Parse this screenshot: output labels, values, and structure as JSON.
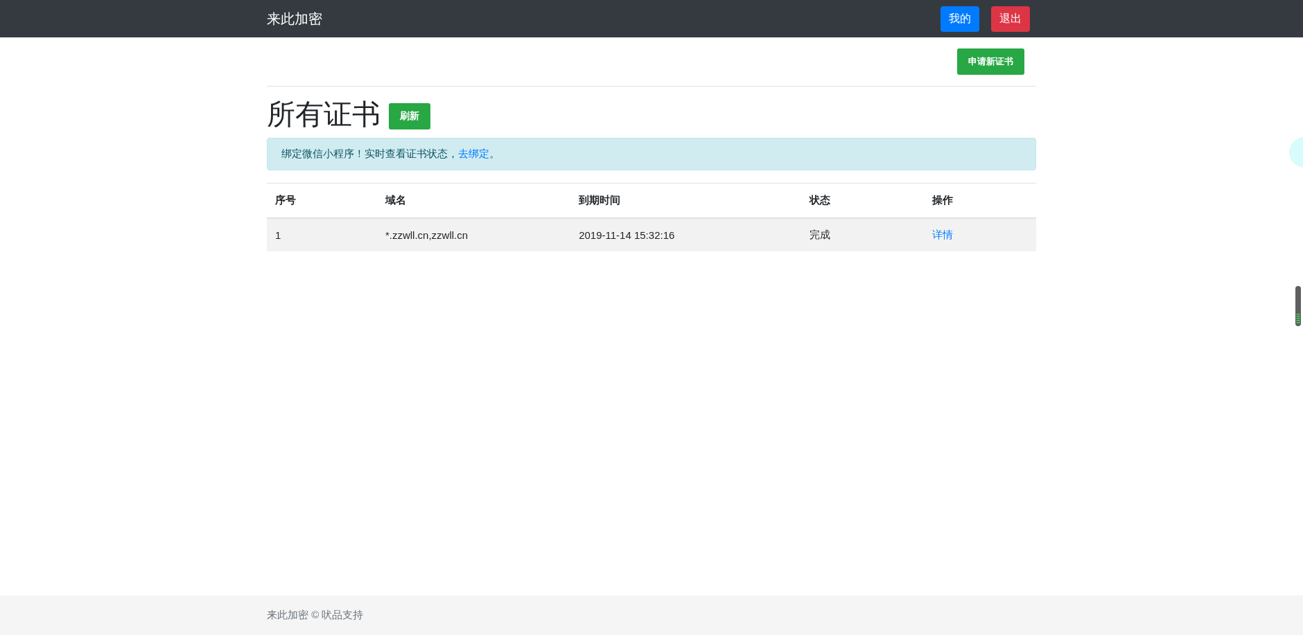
{
  "navbar": {
    "brand": "来此加密",
    "buttons": [
      {
        "label": "我的",
        "kind": "primary"
      },
      {
        "label": "退出",
        "kind": "danger"
      }
    ]
  },
  "toolbar": {
    "button": "申请新证书"
  },
  "heading": {
    "title": "所有证书",
    "button": "刷新"
  },
  "alert": {
    "text": "绑定微信小程序！实时查看证书状态，",
    "link": "去绑定",
    "suffix": "。"
  },
  "table": {
    "columns": [
      "序号",
      "域名",
      "到期时间",
      "状态",
      "操作"
    ],
    "rows": [
      {
        "cells": [
          "1",
          "*.zzwll.cn,zzwll.cn",
          "2019-11-14 15:32:16",
          "完成"
        ],
        "action": "详情"
      }
    ]
  },
  "footer": {
    "text": "来此加密 © 吠品支持"
  }
}
